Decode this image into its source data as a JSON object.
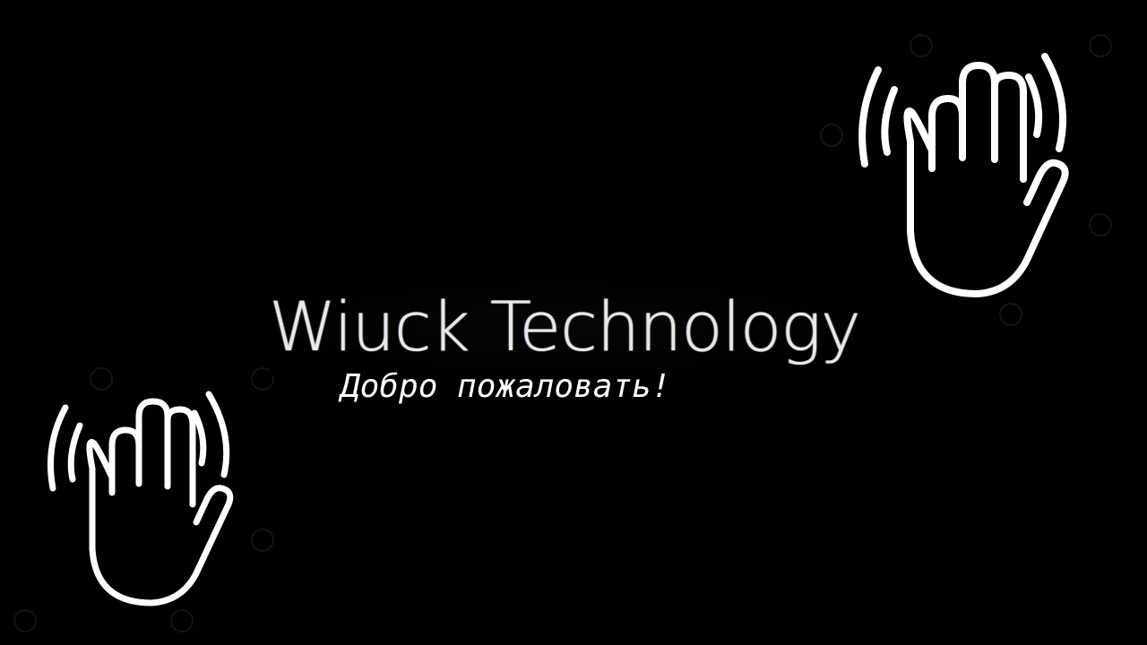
{
  "brand": {
    "name": "Wiuck Technology"
  },
  "greeting": {
    "text": "Добро пожаловать!"
  },
  "icons": {
    "right": "waving-hand-icon",
    "left": "waving-hand-icon"
  },
  "colors": {
    "background": "#000000",
    "foreground": "#ffffff"
  }
}
